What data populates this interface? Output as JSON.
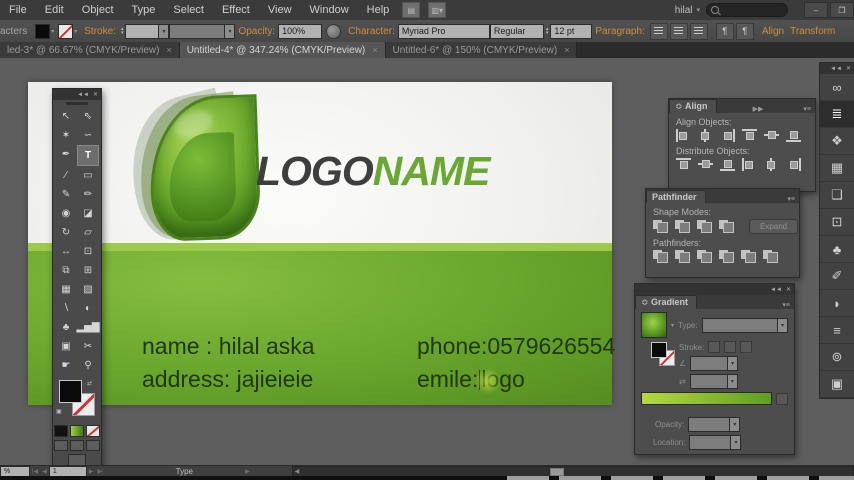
{
  "menubar": {
    "items": [
      "File",
      "Edit",
      "Object",
      "Type",
      "Select",
      "Effect",
      "View",
      "Window",
      "Help"
    ],
    "user": "hilal",
    "minimize": "–",
    "restore": "❐"
  },
  "controlbar": {
    "left_clipped_label": "acters",
    "stroke_label": "Stroke:",
    "opacity_label": "Opacity:",
    "opacity_value": "100%",
    "character_label": "Character:",
    "font_name": "Myriad Pro",
    "font_style": "Regular",
    "font_size": "12 pt",
    "paragraph_label": "Paragraph:",
    "align_label": "Align",
    "transform_label": "Transform"
  },
  "tabs": {
    "close": "×",
    "items": [
      {
        "label": "led-3* @ 66.67% (CMYK/Preview)"
      },
      {
        "label": "Untitled-4* @ 347.24% (CMYK/Preview)"
      },
      {
        "label": "Untitled-6* @ 150% (CMYK/Preview)"
      }
    ]
  },
  "card": {
    "logo_primary": "LOGO",
    "logo_secondary": "NAME",
    "line1_left": "name : hilal aska",
    "line2_left": "address: jajieieie",
    "line1_right": "phone:0579626554",
    "line2_right_before": "emile:",
    "line2_right_after": "logo"
  },
  "tools": {
    "items": [
      {
        "name": "selection",
        "glyph": "↖"
      },
      {
        "name": "direct-selection",
        "glyph": "⇖"
      },
      {
        "name": "magic-wand",
        "glyph": "✶"
      },
      {
        "name": "lasso",
        "glyph": "∽"
      },
      {
        "name": "pen",
        "glyph": "✒"
      },
      {
        "name": "type",
        "glyph": "T"
      },
      {
        "name": "line-segment",
        "glyph": "∕"
      },
      {
        "name": "rectangle",
        "glyph": "▭"
      },
      {
        "name": "paintbrush",
        "glyph": "✎"
      },
      {
        "name": "pencil",
        "glyph": "✏"
      },
      {
        "name": "blob-brush",
        "glyph": "◉"
      },
      {
        "name": "eraser",
        "glyph": "◪"
      },
      {
        "name": "rotate",
        "glyph": "↻"
      },
      {
        "name": "scale",
        "glyph": "▱"
      },
      {
        "name": "width",
        "glyph": "↔"
      },
      {
        "name": "free-transform",
        "glyph": "⊡"
      },
      {
        "name": "shape-builder",
        "glyph": "⧉"
      },
      {
        "name": "perspective-grid",
        "glyph": "⊞"
      },
      {
        "name": "mesh",
        "glyph": "▦"
      },
      {
        "name": "gradient",
        "glyph": "▨"
      },
      {
        "name": "eyedropper",
        "glyph": "∖"
      },
      {
        "name": "blend",
        "glyph": "◐"
      },
      {
        "name": "symbol-sprayer",
        "glyph": "♣"
      },
      {
        "name": "graph",
        "glyph": "▂▅▇"
      },
      {
        "name": "artboard",
        "glyph": "▣"
      },
      {
        "name": "slice",
        "glyph": "✂"
      },
      {
        "name": "hand",
        "glyph": "☛"
      },
      {
        "name": "zoom",
        "glyph": "⚲"
      }
    ]
  },
  "align_panel": {
    "title": "Align",
    "align_objects_label": "Align Objects:",
    "distribute_objects_label": "Distribute Objects:"
  },
  "pathfinder_panel": {
    "title": "Pathfinder",
    "shape_modes_label": "Shape Modes:",
    "expand_label": "Expand",
    "pathfinders_label": "Pathfinders:"
  },
  "gradient_panel": {
    "title": "Gradient",
    "type_label": "Type:",
    "stroke_label": "Stroke:",
    "angle_glyph": "∠",
    "reverse_glyph": "⇄",
    "opacity_label": "Opacity:",
    "location_label": "Location:"
  },
  "dock": {
    "items": [
      {
        "name": "links",
        "glyph": "∞"
      },
      {
        "name": "align",
        "glyph": "≣"
      },
      {
        "name": "pathfinder",
        "glyph": "❖"
      },
      {
        "name": "swatches",
        "glyph": "▦"
      },
      {
        "name": "layers",
        "glyph": "❏"
      },
      {
        "name": "transform",
        "glyph": "⊡"
      },
      {
        "name": "symbols",
        "glyph": "♣"
      },
      {
        "name": "brushes",
        "glyph": "✐"
      },
      {
        "name": "gradient",
        "glyph": "◗"
      },
      {
        "name": "stroke",
        "glyph": "≡"
      },
      {
        "name": "appearance",
        "glyph": "⊚"
      },
      {
        "name": "artboards",
        "glyph": "▣"
      }
    ]
  },
  "statusbar": {
    "zoom_clipped": "%",
    "artboard_number": "1",
    "status": "Type"
  },
  "icons": {
    "collapse": "◄◄",
    "close": "✕",
    "panel_menu": "▾≡",
    "expand_tabs": "▶▶",
    "dropdown": "▾",
    "up": "▴",
    "down": "▾",
    "first": "|◀",
    "prev": "◀",
    "next": "▶",
    "last": "▶|",
    "pilcrow_ltr": "¶",
    "pilcrow_rtl": "¶"
  },
  "colors": {
    "accent_orange": "#cc8f3c",
    "logo_green": "#69a832",
    "card_green": "#68a52c",
    "stripe_green": "#9ccb4b",
    "gradient_bar_start": "#b6d83f",
    "gradient_bar_end": "#5f9e22"
  }
}
